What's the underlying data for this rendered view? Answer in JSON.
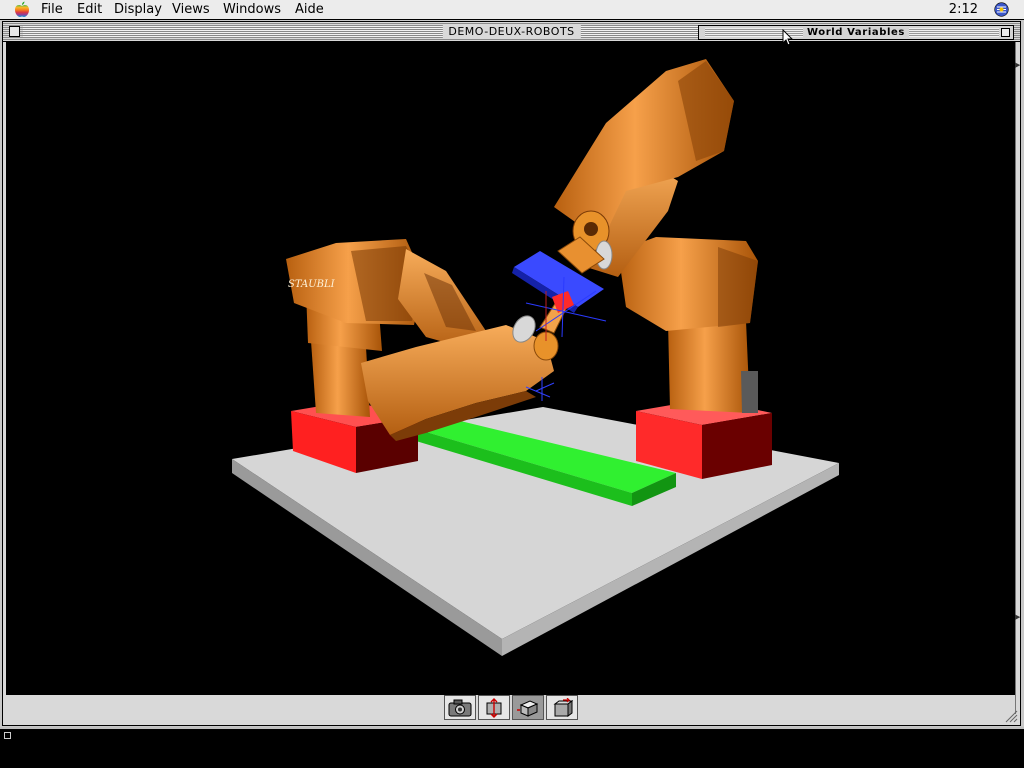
{
  "menubar": {
    "items": [
      "File",
      "Edit",
      "Display",
      "Views",
      "Windows",
      "Aide"
    ],
    "clock": "2:12"
  },
  "window": {
    "title": "DEMO-DEUX-ROBOTS"
  },
  "palette": {
    "title": "World Variables"
  },
  "scene": {
    "robot_brand_label": "STAUBLI",
    "colors": {
      "robot": "#e8922a",
      "pedestal": "#ff2c2c",
      "platform": "#d8d8d8",
      "bar": "#33ff33",
      "tool_plate": "#2d3dff"
    }
  },
  "toolbar": {
    "tools": [
      "camera-icon",
      "move-tool-icon",
      "cube-view-icon",
      "rotate-tool-icon"
    ],
    "active_index": 2
  }
}
